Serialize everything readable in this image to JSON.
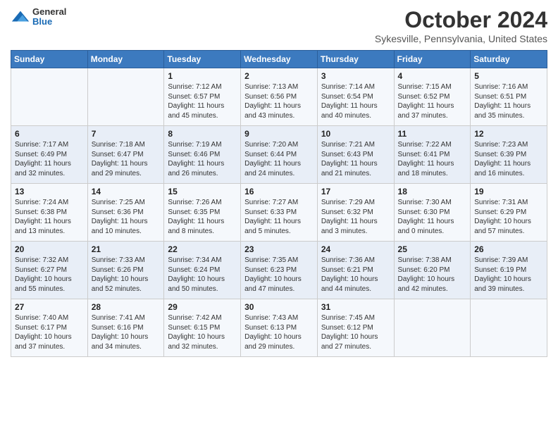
{
  "header": {
    "logo": {
      "general": "General",
      "blue": "Blue"
    },
    "title": "October 2024",
    "location": "Sykesville, Pennsylvania, United States"
  },
  "days_of_week": [
    "Sunday",
    "Monday",
    "Tuesday",
    "Wednesday",
    "Thursday",
    "Friday",
    "Saturday"
  ],
  "weeks": [
    [
      {
        "day": "",
        "info": ""
      },
      {
        "day": "",
        "info": ""
      },
      {
        "day": "1",
        "info": "Sunrise: 7:12 AM\nSunset: 6:57 PM\nDaylight: 11 hours and 45 minutes."
      },
      {
        "day": "2",
        "info": "Sunrise: 7:13 AM\nSunset: 6:56 PM\nDaylight: 11 hours and 43 minutes."
      },
      {
        "day": "3",
        "info": "Sunrise: 7:14 AM\nSunset: 6:54 PM\nDaylight: 11 hours and 40 minutes."
      },
      {
        "day": "4",
        "info": "Sunrise: 7:15 AM\nSunset: 6:52 PM\nDaylight: 11 hours and 37 minutes."
      },
      {
        "day": "5",
        "info": "Sunrise: 7:16 AM\nSunset: 6:51 PM\nDaylight: 11 hours and 35 minutes."
      }
    ],
    [
      {
        "day": "6",
        "info": "Sunrise: 7:17 AM\nSunset: 6:49 PM\nDaylight: 11 hours and 32 minutes."
      },
      {
        "day": "7",
        "info": "Sunrise: 7:18 AM\nSunset: 6:47 PM\nDaylight: 11 hours and 29 minutes."
      },
      {
        "day": "8",
        "info": "Sunrise: 7:19 AM\nSunset: 6:46 PM\nDaylight: 11 hours and 26 minutes."
      },
      {
        "day": "9",
        "info": "Sunrise: 7:20 AM\nSunset: 6:44 PM\nDaylight: 11 hours and 24 minutes."
      },
      {
        "day": "10",
        "info": "Sunrise: 7:21 AM\nSunset: 6:43 PM\nDaylight: 11 hours and 21 minutes."
      },
      {
        "day": "11",
        "info": "Sunrise: 7:22 AM\nSunset: 6:41 PM\nDaylight: 11 hours and 18 minutes."
      },
      {
        "day": "12",
        "info": "Sunrise: 7:23 AM\nSunset: 6:39 PM\nDaylight: 11 hours and 16 minutes."
      }
    ],
    [
      {
        "day": "13",
        "info": "Sunrise: 7:24 AM\nSunset: 6:38 PM\nDaylight: 11 hours and 13 minutes."
      },
      {
        "day": "14",
        "info": "Sunrise: 7:25 AM\nSunset: 6:36 PM\nDaylight: 11 hours and 10 minutes."
      },
      {
        "day": "15",
        "info": "Sunrise: 7:26 AM\nSunset: 6:35 PM\nDaylight: 11 hours and 8 minutes."
      },
      {
        "day": "16",
        "info": "Sunrise: 7:27 AM\nSunset: 6:33 PM\nDaylight: 11 hours and 5 minutes."
      },
      {
        "day": "17",
        "info": "Sunrise: 7:29 AM\nSunset: 6:32 PM\nDaylight: 11 hours and 3 minutes."
      },
      {
        "day": "18",
        "info": "Sunrise: 7:30 AM\nSunset: 6:30 PM\nDaylight: 11 hours and 0 minutes."
      },
      {
        "day": "19",
        "info": "Sunrise: 7:31 AM\nSunset: 6:29 PM\nDaylight: 10 hours and 57 minutes."
      }
    ],
    [
      {
        "day": "20",
        "info": "Sunrise: 7:32 AM\nSunset: 6:27 PM\nDaylight: 10 hours and 55 minutes."
      },
      {
        "day": "21",
        "info": "Sunrise: 7:33 AM\nSunset: 6:26 PM\nDaylight: 10 hours and 52 minutes."
      },
      {
        "day": "22",
        "info": "Sunrise: 7:34 AM\nSunset: 6:24 PM\nDaylight: 10 hours and 50 minutes."
      },
      {
        "day": "23",
        "info": "Sunrise: 7:35 AM\nSunset: 6:23 PM\nDaylight: 10 hours and 47 minutes."
      },
      {
        "day": "24",
        "info": "Sunrise: 7:36 AM\nSunset: 6:21 PM\nDaylight: 10 hours and 44 minutes."
      },
      {
        "day": "25",
        "info": "Sunrise: 7:38 AM\nSunset: 6:20 PM\nDaylight: 10 hours and 42 minutes."
      },
      {
        "day": "26",
        "info": "Sunrise: 7:39 AM\nSunset: 6:19 PM\nDaylight: 10 hours and 39 minutes."
      }
    ],
    [
      {
        "day": "27",
        "info": "Sunrise: 7:40 AM\nSunset: 6:17 PM\nDaylight: 10 hours and 37 minutes."
      },
      {
        "day": "28",
        "info": "Sunrise: 7:41 AM\nSunset: 6:16 PM\nDaylight: 10 hours and 34 minutes."
      },
      {
        "day": "29",
        "info": "Sunrise: 7:42 AM\nSunset: 6:15 PM\nDaylight: 10 hours and 32 minutes."
      },
      {
        "day": "30",
        "info": "Sunrise: 7:43 AM\nSunset: 6:13 PM\nDaylight: 10 hours and 29 minutes."
      },
      {
        "day": "31",
        "info": "Sunrise: 7:45 AM\nSunset: 6:12 PM\nDaylight: 10 hours and 27 minutes."
      },
      {
        "day": "",
        "info": ""
      },
      {
        "day": "",
        "info": ""
      }
    ]
  ]
}
